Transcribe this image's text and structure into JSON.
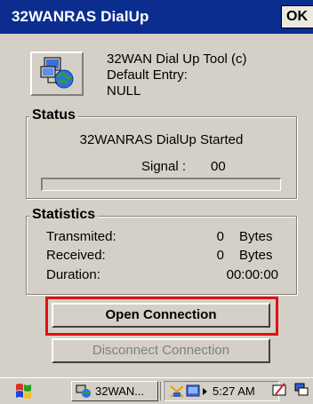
{
  "window": {
    "title": "32WANRAS DialUp",
    "ok_label": "OK"
  },
  "info": {
    "tool_name": "32WAN Dial Up Tool (c)",
    "default_entry_label": "Default Entry:",
    "default_entry_value": "NULL"
  },
  "status": {
    "label": "Status",
    "message": "32WANRAS DialUp Started",
    "signal_label": "Signal :",
    "signal_value": "00",
    "signal_progress": 0
  },
  "statistics": {
    "label": "Statistics",
    "rows": [
      {
        "label": "Transmited:",
        "value": "0",
        "unit": "Bytes"
      },
      {
        "label": "Received:",
        "value": "0",
        "unit": "Bytes"
      },
      {
        "label": "Duration:",
        "value": "00:00:00"
      }
    ]
  },
  "buttons": {
    "open": "Open Connection",
    "disconnect": "Disconnect Connection"
  },
  "taskbar": {
    "task_label": "32WAN...",
    "clock": "5:27 AM"
  },
  "colors": {
    "titlebar": "#0b2d8f",
    "highlight": "#e01010"
  }
}
